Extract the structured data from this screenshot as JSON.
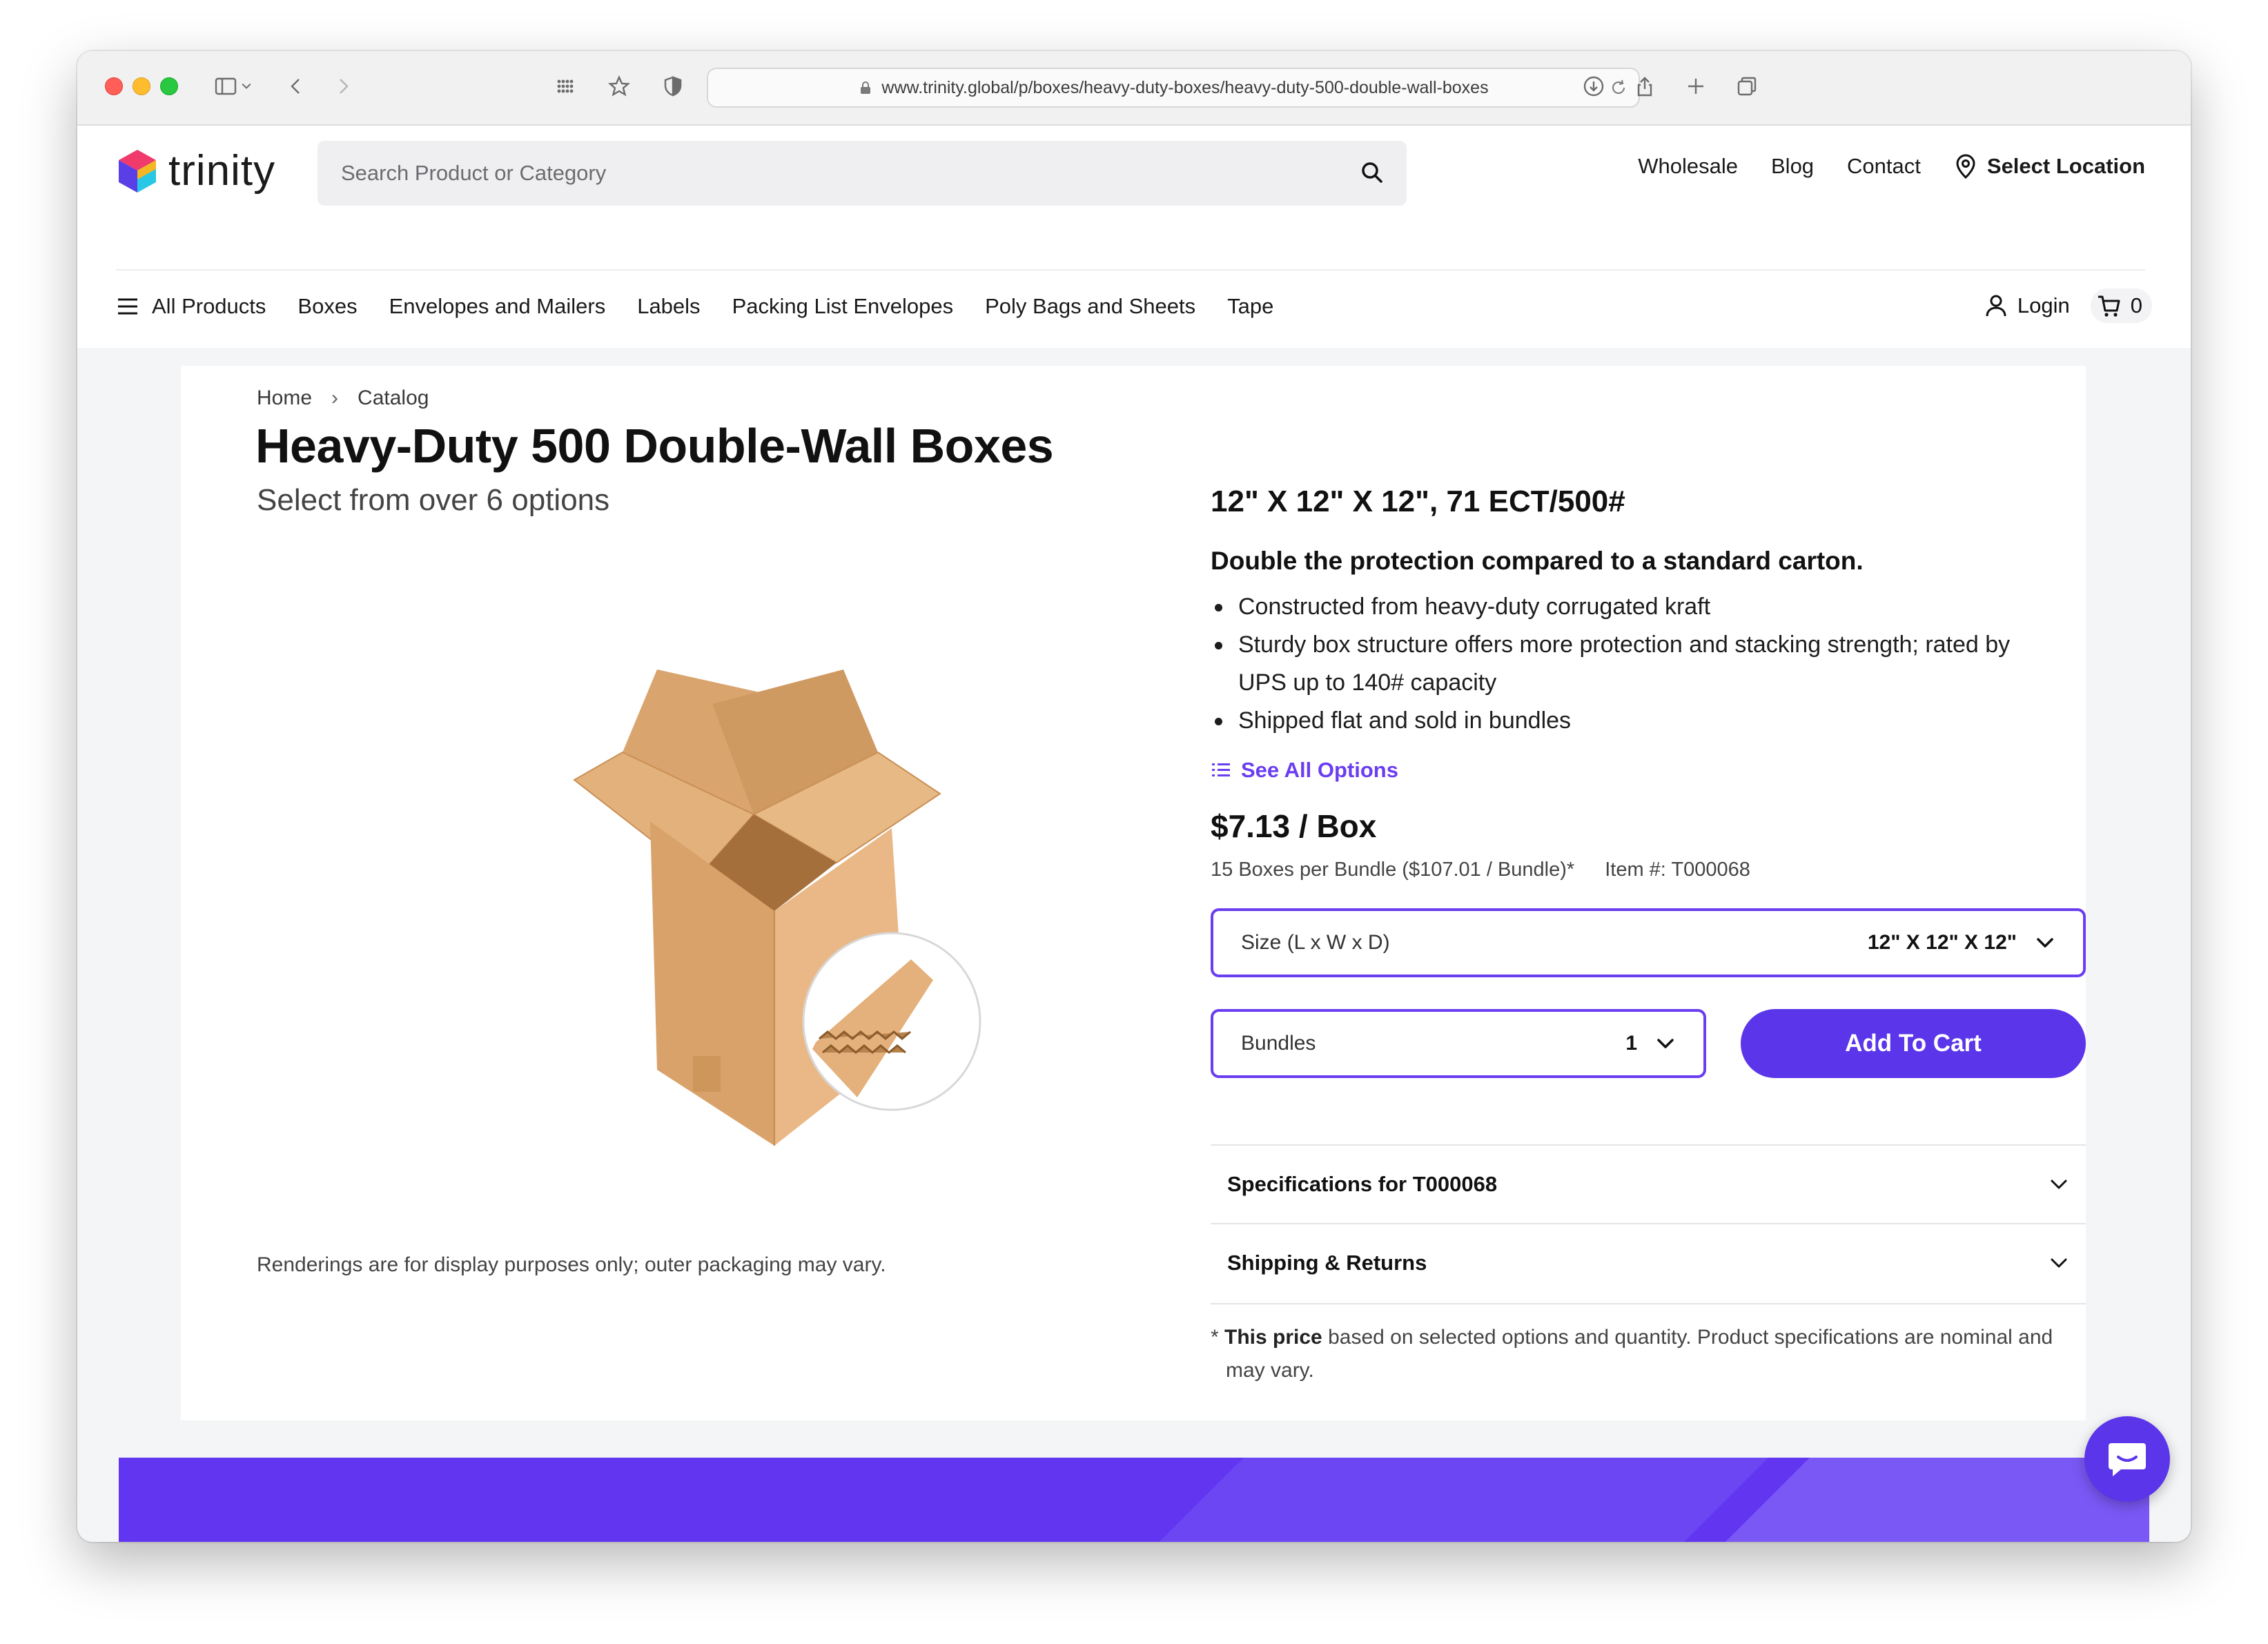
{
  "browser": {
    "url": "www.trinity.global/p/boxes/heavy-duty-boxes/heavy-duty-500-double-wall-boxes"
  },
  "header": {
    "logo_text": "trinity",
    "search_placeholder": "Search Product or Category",
    "top_links": [
      "Wholesale",
      "Blog",
      "Contact"
    ],
    "select_location": "Select Location",
    "nav": {
      "all_products": "All Products",
      "categories": [
        "Boxes",
        "Envelopes and Mailers",
        "Labels",
        "Packing List Envelopes",
        "Poly Bags and Sheets",
        "Tape"
      ]
    },
    "login": "Login",
    "cart_count": "0"
  },
  "breadcrumb": [
    "Home",
    "Catalog"
  ],
  "product": {
    "title": "Heavy-Duty 500 Double-Wall Boxes",
    "subtitle": "Select from over 6 options",
    "variant_title": "12\" X 12\" X 12\", 71 ECT/500#",
    "tagline": "Double the protection compared to a standard carton.",
    "bullets": [
      "Constructed from heavy-duty corrugated kraft",
      "Sturdy box structure offers more protection and stacking strength; rated by UPS up to 140# capacity",
      "Shipped flat and sold in bundles"
    ],
    "see_all": "See All Options",
    "price": "$7.13 / Box",
    "bundle_info": "15 Boxes per Bundle ($107.01 / Bundle)*",
    "item_number": "Item #: T000068",
    "size_label": "Size (L x W x D)",
    "size_value": "12\" X 12\" X 12\"",
    "bundles_label": "Bundles",
    "bundles_value": "1",
    "add_to_cart": "Add To Cart",
    "accordion": [
      "Specifications for T000068",
      "Shipping & Returns"
    ],
    "footnote_bold": "This price",
    "footnote_rest": " based on selected options and quantity. Product specifications are nominal and may vary.",
    "render_note": "Renderings are for display purposes only; outer packaging may vary."
  },
  "colors": {
    "accent": "#5b35ea",
    "link": "#6a3ef0"
  }
}
